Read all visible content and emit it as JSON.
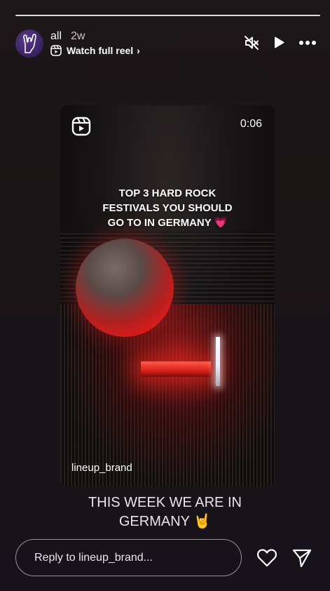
{
  "progress": {
    "segments": 1
  },
  "header": {
    "username": "all",
    "time_ago": "2w",
    "watch_label": "Watch full reel",
    "chevron": "›",
    "icons": {
      "reel": "reel-icon",
      "mute": "muted-speaker-icon",
      "play": "play-icon",
      "more": "more-options-icon"
    }
  },
  "reel_card": {
    "duration": "0:06",
    "overlay_lines": [
      "TOP 3 HARD ROCK",
      "FESTIVALS YOU SHOULD",
      "GO TO IN GERMANY 💗"
    ],
    "brand_handle": "lineup_brand"
  },
  "caption": {
    "lines": [
      "THIS WEEK WE ARE IN",
      "GERMANY 🤘"
    ]
  },
  "reply": {
    "placeholder": "Reply to lineup_brand..."
  },
  "colors": {
    "background": "#1a1516",
    "text": "#ffffff",
    "stage_red": "#d81c1c"
  }
}
